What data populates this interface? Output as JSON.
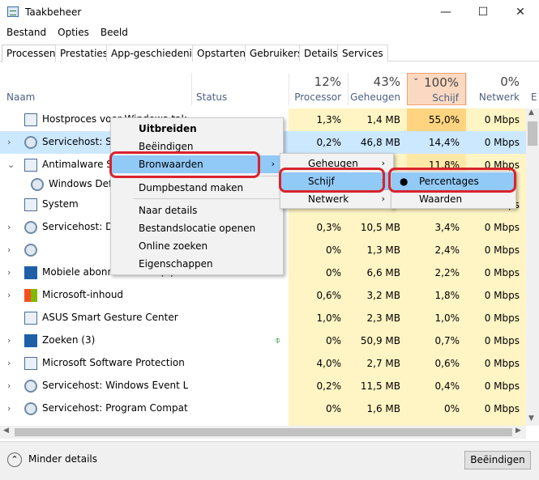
{
  "window": {
    "title": "Taakbeheer",
    "min_glyph": "—",
    "max_glyph": "☐",
    "close_glyph": "✕"
  },
  "menu": [
    "Bestand",
    "Opties",
    "Beeld"
  ],
  "tabs": [
    "Processen",
    "Prestaties",
    "App-geschiedenis",
    "Opstarten",
    "Gebruikers",
    "Details",
    "Services"
  ],
  "columns": {
    "name": "Naam",
    "status": "Status",
    "cpu": {
      "pct": "12%",
      "label": "Processor"
    },
    "mem": {
      "pct": "43%",
      "label": "Geheugen"
    },
    "disk": {
      "pct": "100%",
      "label": "Schijf"
    },
    "net": {
      "pct": "0%",
      "label": "Netwerk"
    },
    "extra": "E"
  },
  "rows": [
    {
      "name": "Hostproces voor Windows-taken",
      "cpu": "1,3%",
      "mem": "1,4 MB",
      "disk": "55,0%",
      "net": "0 Mbps"
    },
    {
      "name": "Servicehost: Systeem",
      "cpu": "0,2%",
      "mem": "46,8 MB",
      "disk": "14,4%",
      "net": "0 Mbps"
    },
    {
      "name": "Antimalware Service Executable",
      "cpu": "",
      "mem": "",
      "disk": "11,8%",
      "net": "0 Mbps"
    },
    {
      "name": "Windows Defender",
      "cpu": "",
      "mem": "",
      "disk": "",
      "net": ""
    },
    {
      "name": "System",
      "cpu": "",
      "mem": "",
      "disk": "",
      "net": "0 Mbps"
    },
    {
      "name": "Servicehost: Diagnostics",
      "cpu": "0,3%",
      "mem": "10,5 MB",
      "disk": "3,4%",
      "net": "0 Mbps"
    },
    {
      "name": "",
      "cpu": "0%",
      "mem": "1,3 MB",
      "disk": "2,4%",
      "net": "0 Mbps"
    },
    {
      "name": "Mobiele abonnementen (2)",
      "cpu": "0%",
      "mem": "6,6 MB",
      "disk": "2,2%",
      "net": "0 Mbps"
    },
    {
      "name": "Microsoft-inhoud",
      "cpu": "0,6%",
      "mem": "3,2 MB",
      "disk": "1,8%",
      "net": "0 Mbps"
    },
    {
      "name": "ASUS Smart Gesture Center",
      "cpu": "1,0%",
      "mem": "2,3 MB",
      "disk": "1,0%",
      "net": "0 Mbps"
    },
    {
      "name": "Zoeken (3)",
      "cpu": "0%",
      "mem": "50,9 MB",
      "disk": "0,7%",
      "net": "0 Mbps"
    },
    {
      "name": "Microsoft Software Protection P...",
      "cpu": "4,0%",
      "mem": "2,7 MB",
      "disk": "0,6%",
      "net": "0 Mbps"
    },
    {
      "name": "Servicehost: Windows Event Log",
      "cpu": "0,2%",
      "mem": "11,5 MB",
      "disk": "0,4%",
      "net": "0 Mbps"
    },
    {
      "name": "Servicehost: Program Compatibi...",
      "cpu": "0%",
      "mem": "1,6 MB",
      "disk": "0%",
      "net": "0 Mbps"
    }
  ],
  "context_menu": [
    "Uitbreiden",
    "Beëindigen",
    "Bronwaarden",
    "Dumpbestand maken",
    "Naar details",
    "Bestandslocatie openen",
    "Online zoeken",
    "Eigenschappen"
  ],
  "submenu1": [
    "Geheugen",
    "Schijf",
    "Netwerk"
  ],
  "submenu2": [
    "Percentages",
    "Waarden"
  ],
  "footer": {
    "less_details": "Minder details",
    "end_task": "Beëindigen"
  }
}
